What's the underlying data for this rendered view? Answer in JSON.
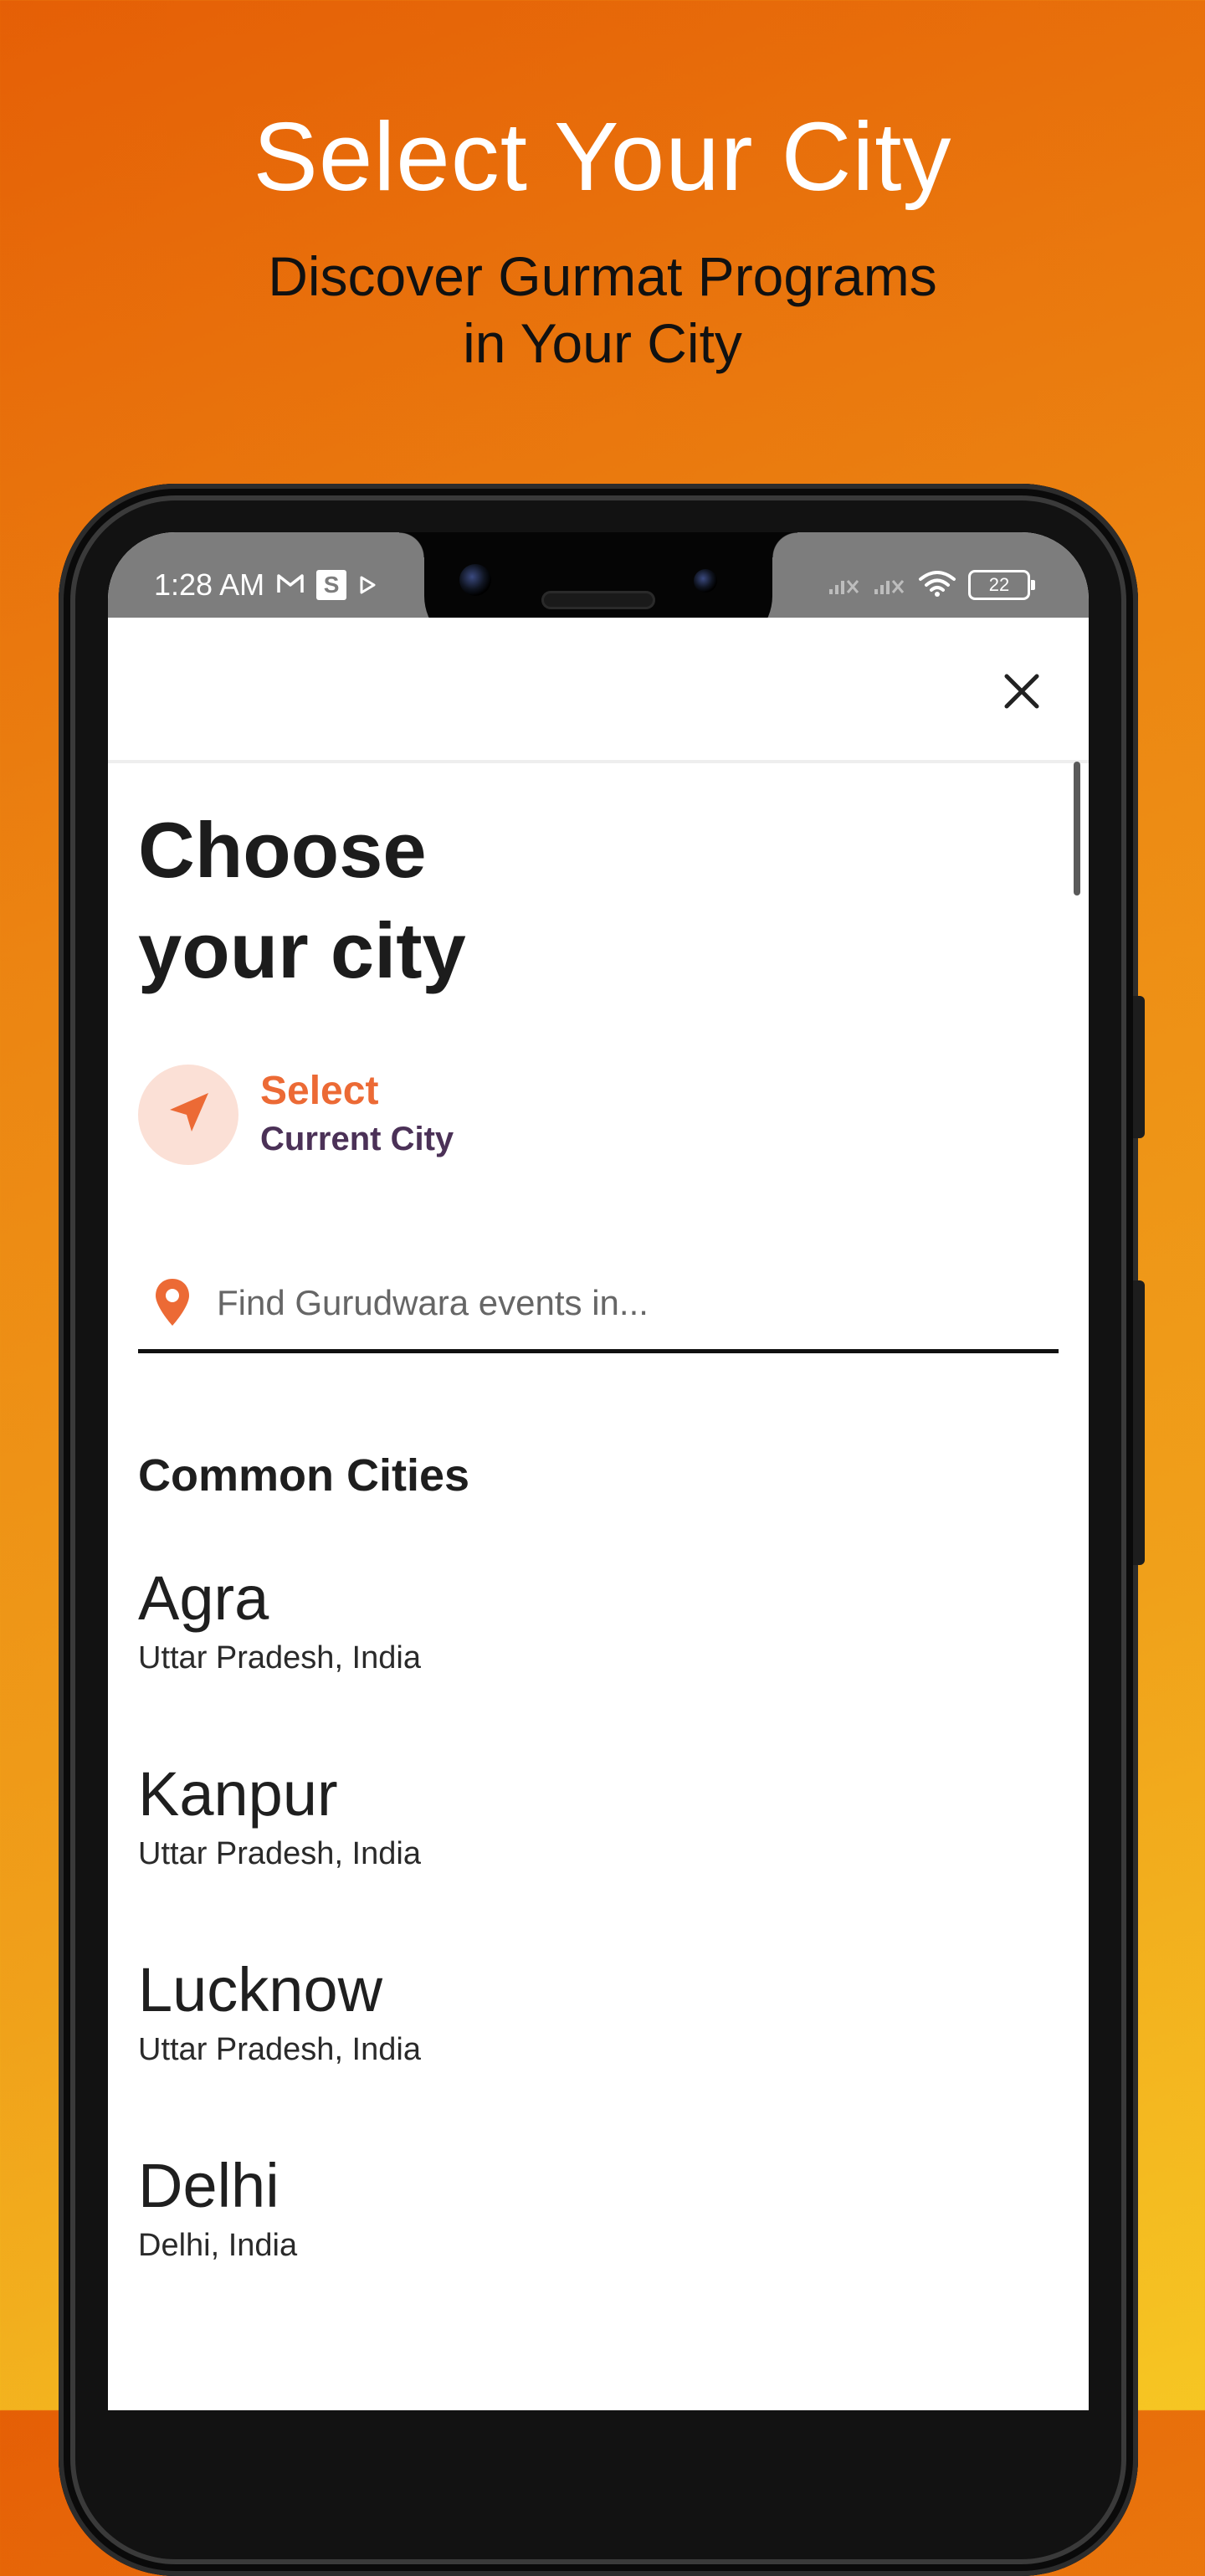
{
  "promo": {
    "title": "Select Your City",
    "subtitle_line1": "Discover Gurmat Programs",
    "subtitle_line2": "in Your City"
  },
  "status_bar": {
    "time": "1:28 AM",
    "s_icon": "S",
    "battery": "22"
  },
  "icons": {
    "close": "close-icon",
    "navigation": "navigation-arrow-icon",
    "pin": "map-pin-icon"
  },
  "colors": {
    "accent": "#ec6a35",
    "secondary": "#4b3157"
  },
  "page": {
    "heading_line1": "Choose",
    "heading_line2": "your city"
  },
  "current_city": {
    "line1": "Select",
    "line2": "Current City"
  },
  "search": {
    "placeholder": "Find Gurudwara events in..."
  },
  "common_cities": {
    "title": "Common Cities",
    "items": [
      {
        "name": "Agra",
        "region": "Uttar Pradesh, India"
      },
      {
        "name": "Kanpur",
        "region": "Uttar Pradesh, India"
      },
      {
        "name": "Lucknow",
        "region": "Uttar Pradesh, India"
      },
      {
        "name": "Delhi",
        "region": "Delhi, India"
      }
    ]
  }
}
